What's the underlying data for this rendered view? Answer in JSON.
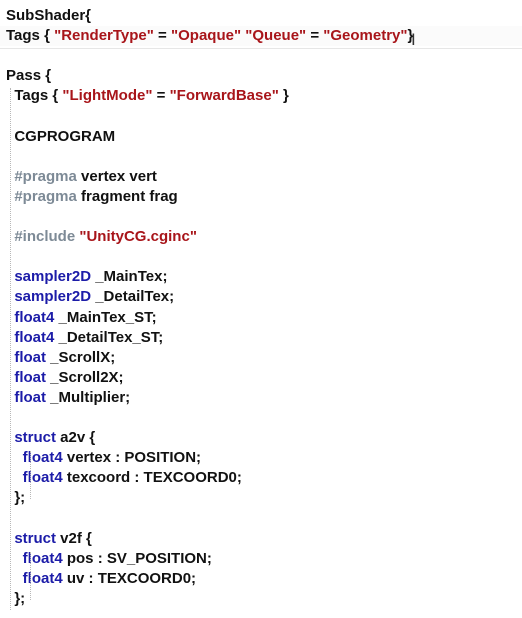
{
  "theme": {
    "background": "#ffffff",
    "default_text": "#111111",
    "keyword": "#1c1ca8",
    "string": "#a8151a",
    "preprocessor": "#7d8a96",
    "guide": "#b8b8b8"
  },
  "editor": {
    "cursor_glyph": "I",
    "lines": [
      {
        "tokens": [
          {
            "t": "SubShader{",
            "c": "default_text"
          }
        ]
      },
      {
        "tokens": [
          {
            "t": "Tags { ",
            "c": "default_text"
          },
          {
            "t": "\"RenderType\"",
            "c": "string"
          },
          {
            "t": " = ",
            "c": "default_text"
          },
          {
            "t": "\"Opaque\"",
            "c": "string"
          },
          {
            "t": " ",
            "c": "default_text"
          },
          {
            "t": "\"Queue\"",
            "c": "string"
          },
          {
            "t": " = ",
            "c": "default_text"
          },
          {
            "t": "\"Geometry\"",
            "c": "string"
          },
          {
            "t": "}",
            "c": "default_text"
          }
        ]
      },
      {
        "tokens": []
      },
      {
        "tokens": [
          {
            "t": "Pass {",
            "c": "default_text"
          }
        ]
      },
      {
        "tokens": [
          {
            "t": "  Tags { ",
            "c": "default_text"
          },
          {
            "t": "\"LightMode\"",
            "c": "string"
          },
          {
            "t": " = ",
            "c": "default_text"
          },
          {
            "t": "\"ForwardBase\"",
            "c": "string"
          },
          {
            "t": " }",
            "c": "default_text"
          }
        ]
      },
      {
        "tokens": []
      },
      {
        "tokens": [
          {
            "t": "  CGPROGRAM",
            "c": "default_text"
          }
        ]
      },
      {
        "tokens": []
      },
      {
        "tokens": [
          {
            "t": "  #pragma",
            "c": "preprocessor"
          },
          {
            "t": " vertex vert",
            "c": "default_text"
          }
        ]
      },
      {
        "tokens": [
          {
            "t": "  #pragma",
            "c": "preprocessor"
          },
          {
            "t": " fragment frag",
            "c": "default_text"
          }
        ]
      },
      {
        "tokens": []
      },
      {
        "tokens": [
          {
            "t": "  #include",
            "c": "preprocessor"
          },
          {
            "t": " ",
            "c": "default_text"
          },
          {
            "t": "\"UnityCG.cginc\"",
            "c": "string"
          }
        ]
      },
      {
        "tokens": []
      },
      {
        "tokens": [
          {
            "t": "  sampler2D",
            "c": "keyword"
          },
          {
            "t": " _MainTex;",
            "c": "default_text"
          }
        ]
      },
      {
        "tokens": [
          {
            "t": "  sampler2D",
            "c": "keyword"
          },
          {
            "t": " _DetailTex;",
            "c": "default_text"
          }
        ]
      },
      {
        "tokens": [
          {
            "t": "  float4",
            "c": "keyword"
          },
          {
            "t": " _MainTex_ST;",
            "c": "default_text"
          }
        ]
      },
      {
        "tokens": [
          {
            "t": "  float4",
            "c": "keyword"
          },
          {
            "t": " _DetailTex_ST;",
            "c": "default_text"
          }
        ]
      },
      {
        "tokens": [
          {
            "t": "  float",
            "c": "keyword"
          },
          {
            "t": " _ScrollX;",
            "c": "default_text"
          }
        ]
      },
      {
        "tokens": [
          {
            "t": "  float",
            "c": "keyword"
          },
          {
            "t": " _Scroll2X;",
            "c": "default_text"
          }
        ]
      },
      {
        "tokens": [
          {
            "t": "  float",
            "c": "keyword"
          },
          {
            "t": " _Multiplier;",
            "c": "default_text"
          }
        ]
      },
      {
        "tokens": []
      },
      {
        "tokens": [
          {
            "t": "  struct",
            "c": "keyword"
          },
          {
            "t": " a2v {",
            "c": "default_text"
          }
        ]
      },
      {
        "tokens": [
          {
            "t": "    float4",
            "c": "keyword"
          },
          {
            "t": " vertex : POSITION;",
            "c": "default_text"
          }
        ]
      },
      {
        "tokens": [
          {
            "t": "    float4",
            "c": "keyword"
          },
          {
            "t": " texcoord : TEXCOORD0;",
            "c": "default_text"
          }
        ]
      },
      {
        "tokens": [
          {
            "t": "  };",
            "c": "default_text"
          }
        ]
      },
      {
        "tokens": []
      },
      {
        "tokens": [
          {
            "t": "  struct",
            "c": "keyword"
          },
          {
            "t": " v2f {",
            "c": "default_text"
          }
        ]
      },
      {
        "tokens": [
          {
            "t": "    float4",
            "c": "keyword"
          },
          {
            "t": " pos : SV_POSITION;",
            "c": "default_text"
          }
        ]
      },
      {
        "tokens": [
          {
            "t": "    float4",
            "c": "keyword"
          },
          {
            "t": " uv : TEXCOORD0;",
            "c": "default_text"
          }
        ]
      },
      {
        "tokens": [
          {
            "t": "  };",
            "c": "default_text"
          }
        ]
      }
    ]
  }
}
